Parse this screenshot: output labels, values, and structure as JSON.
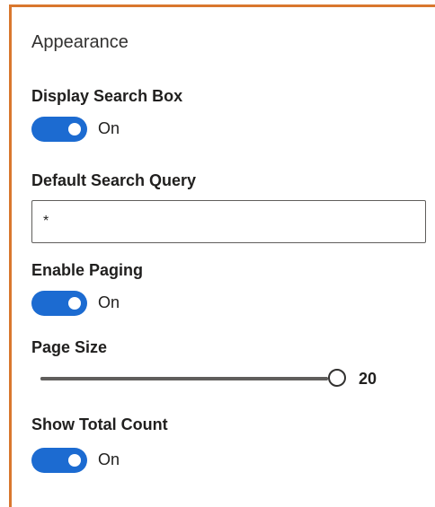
{
  "panel": {
    "section_title": "Appearance",
    "display_search_box": {
      "label": "Display Search Box",
      "state": "On",
      "checked": true
    },
    "default_search_query": {
      "label": "Default Search Query",
      "value": "*"
    },
    "enable_paging": {
      "label": "Enable Paging",
      "state": "On",
      "checked": true
    },
    "page_size": {
      "label": "Page Size",
      "value": "20",
      "fraction": 1.0
    },
    "show_total_count": {
      "label": "Show Total Count",
      "state": "On",
      "checked": true
    }
  },
  "colors": {
    "accent": "#1c6bd1",
    "frame_border": "#d9772e"
  }
}
